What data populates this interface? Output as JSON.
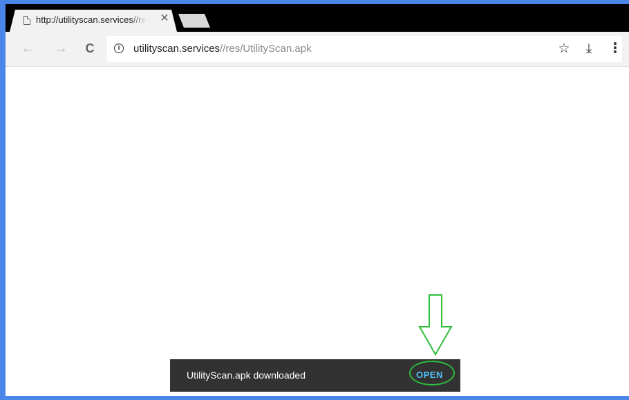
{
  "tab": {
    "title": "http://utilityscan.services//res/UtilityScan.apk",
    "close_glyph": "✕",
    "icon": "page-icon"
  },
  "toolbar": {
    "back_glyph": "←",
    "forward_glyph": "→",
    "reload_glyph": "C",
    "info_glyph": "i",
    "url_host": "utilityscan.services",
    "url_path": "//res/UtilityScan.apk",
    "bookmark_glyph": "☆",
    "download_glyph": "⤓",
    "menu_glyph": "⋮"
  },
  "snackbar": {
    "message": "UtilityScan.apk downloaded",
    "action_label": "OPEN"
  },
  "colors": {
    "frame": "#4a86e8",
    "annotation": "#2ebd3c",
    "action": "#4fc3f7"
  }
}
